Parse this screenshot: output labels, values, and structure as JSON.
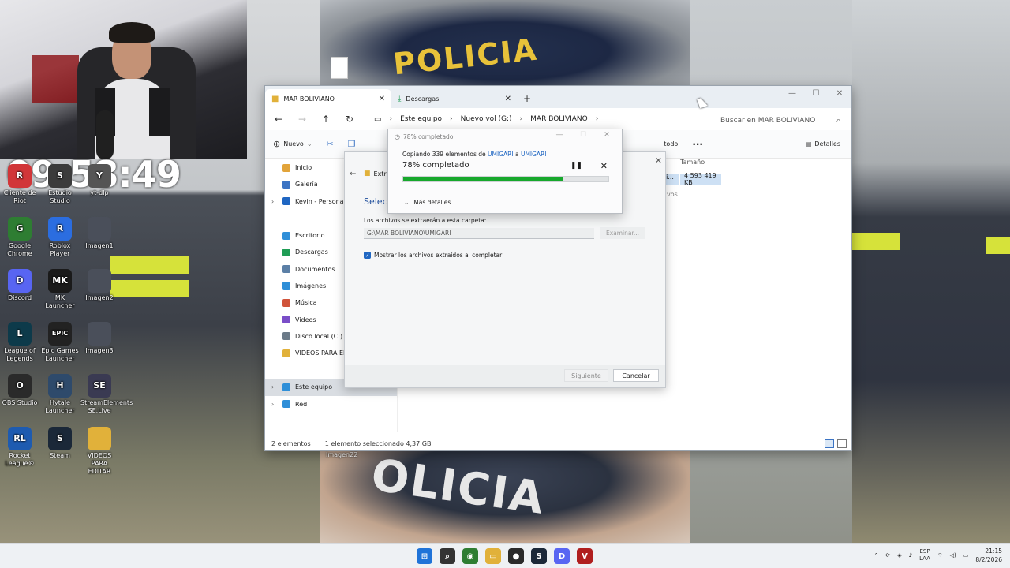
{
  "clock": "09:58:49",
  "desktop_icons": [
    {
      "label": "Cliente de Riot",
      "color": "#d13639",
      "glyph": "R"
    },
    {
      "label": "Estudio Studio",
      "color": "#3b3b3b",
      "glyph": "S"
    },
    {
      "label": "yt-dlp",
      "color": "#555555",
      "glyph": "Y"
    },
    {
      "label": "Google Chrome",
      "color": "#2e7d32",
      "glyph": "G"
    },
    {
      "label": "Roblox Player",
      "color": "#2b6de0",
      "glyph": "R"
    },
    {
      "label": "Imagen1",
      "color": "#4a4f5a",
      "glyph": ""
    },
    {
      "label": "Discord",
      "color": "#5865f2",
      "glyph": "D"
    },
    {
      "label": "MK Launcher",
      "color": "#1a1a1a",
      "glyph": "MK"
    },
    {
      "label": "Imagen2",
      "color": "#4a4f5a",
      "glyph": ""
    },
    {
      "label": "League of Legends",
      "color": "#0d3a4a",
      "glyph": "L"
    },
    {
      "label": "Epic Games Launcher",
      "color": "#222222",
      "glyph": "EPIC"
    },
    {
      "label": "Imagen3",
      "color": "#4a4f5a",
      "glyph": ""
    },
    {
      "label": "OBS Studio",
      "color": "#2a2a2a",
      "glyph": "O"
    },
    {
      "label": "Hytale Launcher",
      "color": "#2e4a6b",
      "glyph": "H"
    },
    {
      "label": "StreamElements SE.Live",
      "color": "#3a3a52",
      "glyph": "SE"
    },
    {
      "label": "Rocket League®",
      "color": "#1e5bb0",
      "glyph": "RL"
    },
    {
      "label": "Steam",
      "color": "#1b2838",
      "glyph": "S"
    },
    {
      "label": "VIDEOS PARA EDITAR",
      "color": "#e1b13a",
      "glyph": ""
    }
  ],
  "desktop_other": {
    "imagen22": "Imagen22"
  },
  "explorer": {
    "tabs": [
      {
        "label": "MAR BOLIVIANO"
      },
      {
        "label": "Descargas"
      }
    ],
    "breadcrumb": [
      "Este equipo",
      "Nuevo vol (G:)",
      "MAR BOLIVIANO"
    ],
    "search_placeholder": "Buscar en MAR BOLIVIANO",
    "toolbar": {
      "new_label": "Nuevo",
      "select_all_fragment": "todo",
      "details_label": "Detalles"
    },
    "sidebar": [
      {
        "label": "Inicio",
        "color": "#e2a43a"
      },
      {
        "label": "Galería",
        "color": "#3c74c4"
      },
      {
        "label": "Kevin - Personal",
        "color": "#1f66c2",
        "chevron": true
      },
      {
        "label": "Escritorio",
        "color": "#2f8fd8"
      },
      {
        "label": "Descargas",
        "color": "#1f9d55"
      },
      {
        "label": "Documentos",
        "color": "#5b7fa6"
      },
      {
        "label": "Imágenes",
        "color": "#2f8fd8"
      },
      {
        "label": "Música",
        "color": "#d0533a"
      },
      {
        "label": "Videos",
        "color": "#7a4ec8"
      },
      {
        "label": "Disco local (C:)",
        "color": "#6b7a88"
      },
      {
        "label": "VIDEOS PARA EDITAR",
        "color": "#e1b13a"
      },
      {
        "label": "Este equipo",
        "color": "#2f8fd8",
        "chevron": true,
        "selected": true
      },
      {
        "label": "Red",
        "color": "#2f8fd8",
        "chevron": true
      }
    ],
    "columns": {
      "size": "Tamaño"
    },
    "file_row": {
      "size": "4 593 419 KB",
      "name_fragment": "ni...",
      "type_fragment": "vos"
    },
    "status": {
      "count": "2 elementos",
      "selection": "1 elemento seleccionado  4,37 GB"
    }
  },
  "wizard": {
    "title_fragment": "Extra",
    "heading_fragment": "Selecc",
    "folder_label": "Los archivos se extraerán a esta carpeta:",
    "folder_path": "G:\\MAR BOLIVIANO\\UMIGARI",
    "browse_label": "Examinar...",
    "show_files_label": "Mostrar los archivos extraídos al completar",
    "next_label": "Siguiente",
    "cancel_label": "Cancelar"
  },
  "progress": {
    "title": "78% completado",
    "copy_prefix": "Copiando 339 elementos de ",
    "source": "UMIGARI",
    "copy_mid": " a ",
    "dest": "UMIGARI",
    "percent_text": "78% completado",
    "percent": 78,
    "more_details": "Más detalles"
  },
  "taskbar": {
    "apps": [
      {
        "name": "start",
        "color": "#1f73d8",
        "glyph": "⊞"
      },
      {
        "name": "search",
        "color": "#333333",
        "glyph": "⌕"
      },
      {
        "name": "chrome",
        "color": "#2e7d32",
        "glyph": "◉"
      },
      {
        "name": "explorer",
        "color": "#e1b13a",
        "glyph": "▭"
      },
      {
        "name": "obs",
        "color": "#2a2a2a",
        "glyph": "●"
      },
      {
        "name": "steam",
        "color": "#1b2838",
        "glyph": "S"
      },
      {
        "name": "discord",
        "color": "#5865f2",
        "glyph": "D"
      },
      {
        "name": "voice",
        "color": "#b01e1e",
        "glyph": "V"
      }
    ],
    "lang": "ESP",
    "lang2": "LAA",
    "time": "21:15",
    "date": "8/2/2026"
  },
  "colors": {
    "accent": "#1f66c2",
    "progress": "#17a82c",
    "selection": "#cde0f4"
  }
}
